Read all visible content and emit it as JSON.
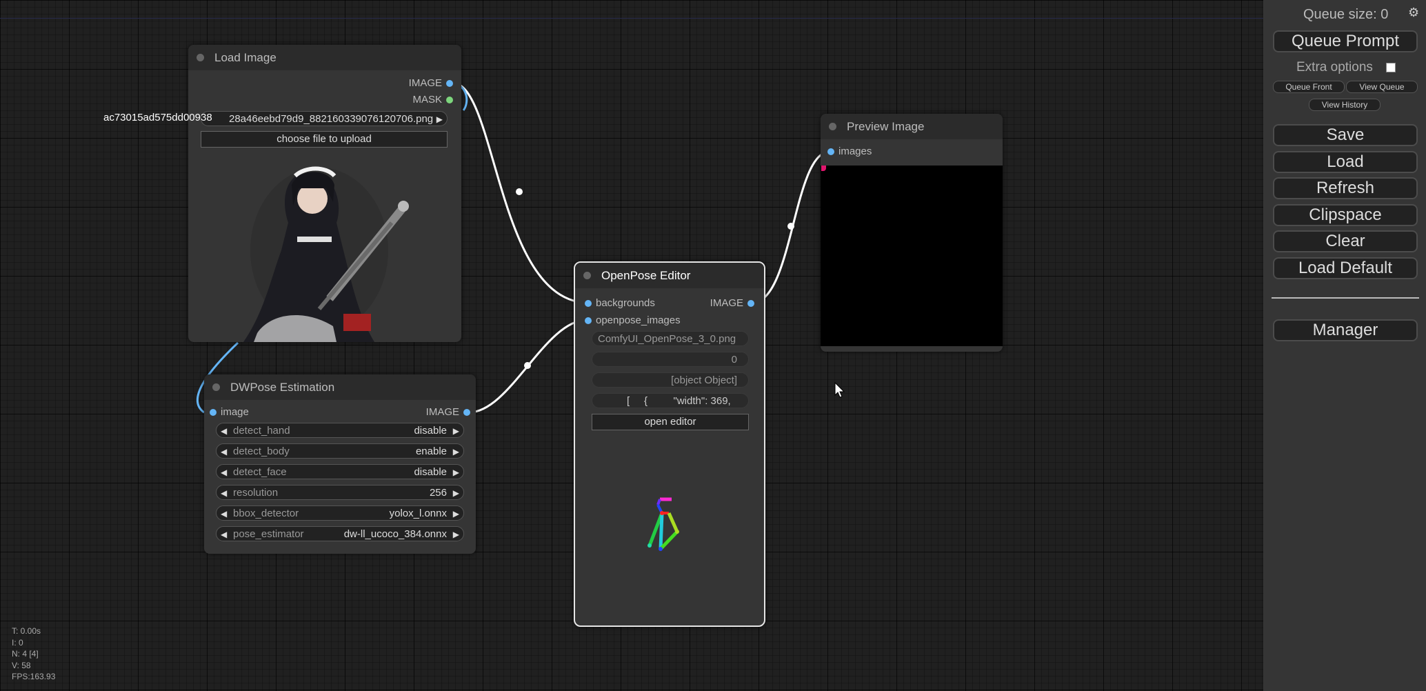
{
  "sidebar": {
    "queue_size": "Queue size: 0",
    "queue_prompt": "Queue Prompt",
    "extra_options": "Extra options",
    "queue_front": "Queue Front",
    "view_queue": "View Queue",
    "view_history": "View History",
    "save": "Save",
    "load": "Load",
    "refresh": "Refresh",
    "clipspace": "Clipspace",
    "clear": "Clear",
    "load_default": "Load Default",
    "manager": "Manager"
  },
  "load_image": {
    "title": "Load Image",
    "outputs": [
      "IMAGE",
      "MASK"
    ],
    "filename_overlay": "ac73015ad575dd00938",
    "filename": "28a46eebd79d9_882160339076120706.png",
    "upload_button": "choose file to upload"
  },
  "dwpose": {
    "title": "DWPose Estimation",
    "input": "image",
    "output": "IMAGE",
    "widgets": [
      {
        "label": "detect_hand",
        "value": "disable"
      },
      {
        "label": "detect_body",
        "value": "enable"
      },
      {
        "label": "detect_face",
        "value": "disable"
      },
      {
        "label": "resolution",
        "value": "256"
      },
      {
        "label": "bbox_detector",
        "value": "yolox_l.onnx"
      },
      {
        "label": "pose_estimator",
        "value": "dw-ll_ucoco_384.onnx"
      }
    ]
  },
  "openpose": {
    "title": "OpenPose Editor",
    "inputs": [
      "backgrounds",
      "openpose_images"
    ],
    "output": "IMAGE",
    "text_fields": [
      "ComfyUI_OpenPose_3_0.png",
      "0",
      "[object Object]",
      "[     {         \"width\": 369,"
    ],
    "open_editor": "open editor"
  },
  "preview": {
    "title": "Preview Image",
    "input": "images"
  },
  "stats": {
    "t": "T: 0.00s",
    "i": "I: 0",
    "n": "N: 4 [4]",
    "v": "V: 58",
    "fps": "FPS:163.93"
  },
  "colors": {
    "canvas_bg": "#202020",
    "node_bg": "#353535",
    "node_title_bg": "#2b2b2b",
    "link": "#ffffff",
    "slot_image": "#64b5f6",
    "slot_mask": "#7dd67d"
  }
}
